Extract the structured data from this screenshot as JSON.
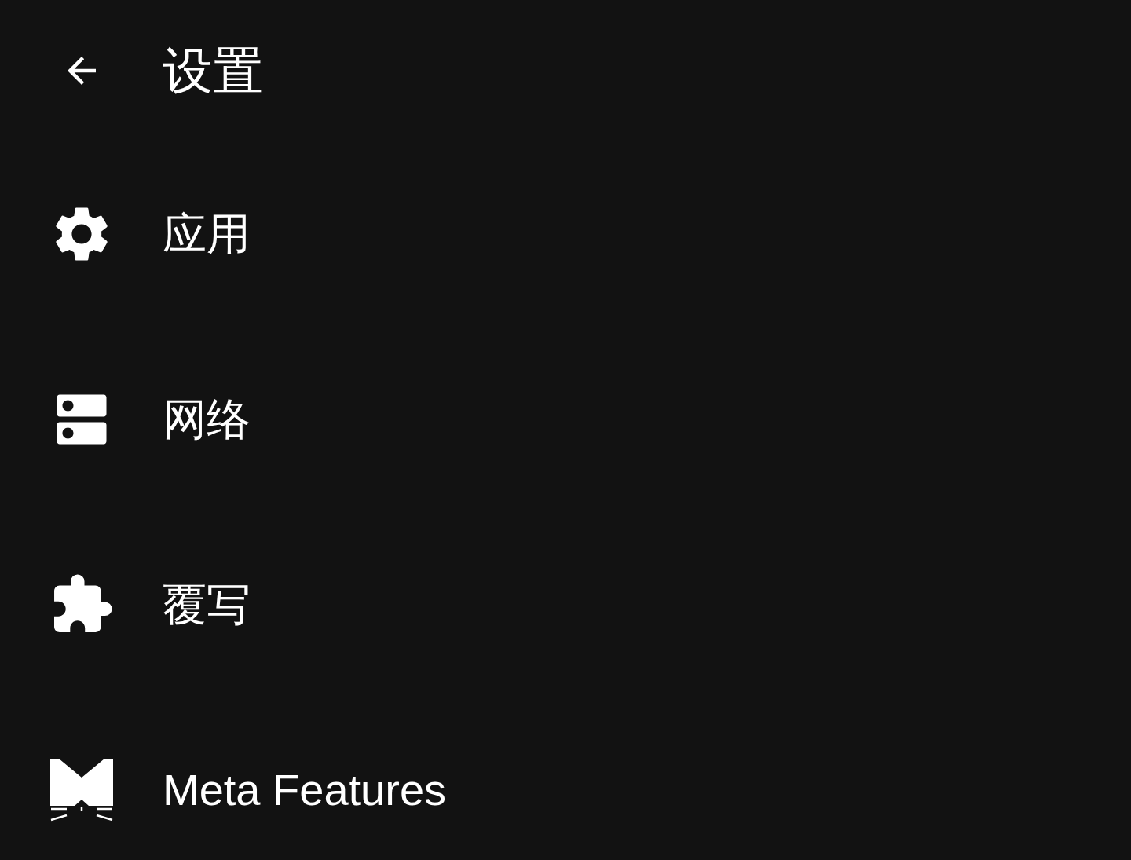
{
  "header": {
    "title": "设置"
  },
  "items": [
    {
      "label": "应用",
      "kind": "gear"
    },
    {
      "label": "网络",
      "kind": "server"
    },
    {
      "label": "覆写",
      "kind": "puzzle"
    },
    {
      "label": "Meta Features",
      "kind": "meta"
    }
  ]
}
